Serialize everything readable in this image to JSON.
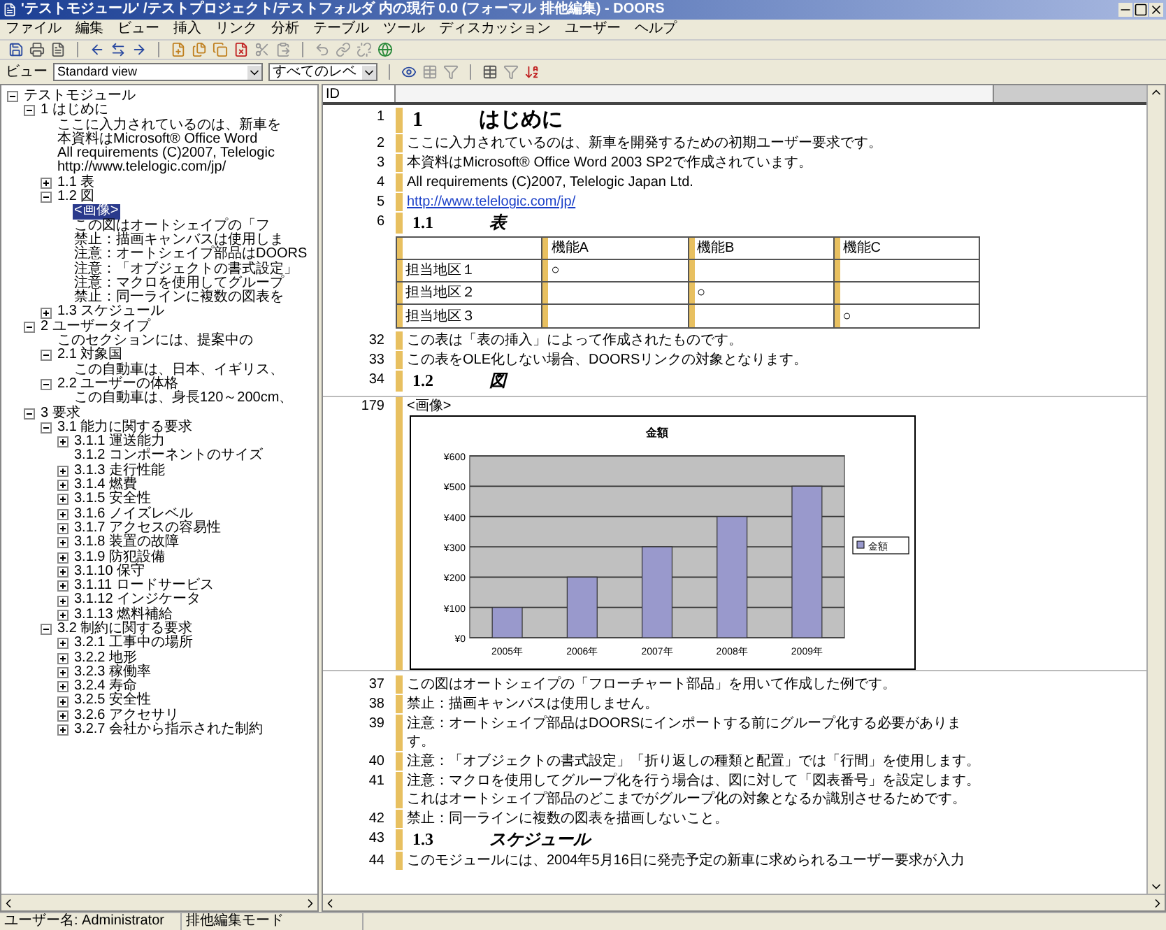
{
  "window": {
    "title": "'テストモジュール' /テストプロジェクト/テストフォルダ 内の現行 0.0 (フォーマル 排他編集) - DOORS"
  },
  "menu": [
    "ファイル",
    "編集",
    "ビュー",
    "挿入",
    "リンク",
    "分析",
    "テーブル",
    "ツール",
    "ディスカッション",
    "ユーザー",
    "ヘルプ"
  ],
  "view_bar": {
    "label": "ビュー",
    "view": "Standard view",
    "level": "すべてのレベ"
  },
  "columns": [
    "ID"
  ],
  "tree": [
    {
      "kind": "branch",
      "label": "テストモジュール",
      "expanded": true,
      "selected": false,
      "children": [
        {
          "kind": "branch",
          "label": "1 はじめに",
          "expanded": true,
          "selected": false,
          "children": [
            {
              "kind": "leaf",
              "label": "ここに入力されているのは、新車を",
              "selected": false
            },
            {
              "kind": "leaf",
              "label": "本資料はMicrosoft® Office Word",
              "selected": false
            },
            {
              "kind": "leaf",
              "label": "All requirements (C)2007, Telelogic",
              "selected": false
            },
            {
              "kind": "leaf",
              "label": "http://www.telelogic.com/jp/",
              "selected": false
            },
            {
              "kind": "branch",
              "label": "1.1 表",
              "expanded": false,
              "selected": false
            },
            {
              "kind": "branch",
              "label": "1.2 図",
              "expanded": true,
              "selected": false,
              "children": [
                {
                  "kind": "leaf",
                  "label": "<画像>",
                  "selected": true
                },
                {
                  "kind": "leaf",
                  "label": "この図はオートシェイプの「フ",
                  "selected": false
                },
                {
                  "kind": "leaf",
                  "label": "禁止：描画キャンバスは使用しま",
                  "selected": false
                },
                {
                  "kind": "leaf",
                  "label": "注意：オートシェイプ部品はDOORS",
                  "selected": false
                },
                {
                  "kind": "leaf",
                  "label": "注意：「オブジェクトの書式設定」",
                  "selected": false
                },
                {
                  "kind": "leaf",
                  "label": "注意：マクロを使用してグループ",
                  "selected": false
                },
                {
                  "kind": "leaf",
                  "label": "禁止：同一ラインに複数の図表を",
                  "selected": false
                }
              ]
            },
            {
              "kind": "branch",
              "label": "1.3 スケジュール",
              "expanded": false,
              "selected": false
            }
          ]
        },
        {
          "kind": "branch",
          "label": "2 ユーザータイプ",
          "expanded": true,
          "selected": false,
          "children": [
            {
              "kind": "leaf",
              "label": "このセクションには、提案中の",
              "selected": false
            },
            {
              "kind": "branch",
              "label": "2.1 対象国",
              "expanded": true,
              "selected": false,
              "children": [
                {
                  "kind": "leaf",
                  "label": "この自動車は、日本、イギリス、",
                  "selected": false
                }
              ]
            },
            {
              "kind": "branch",
              "label": "2.2 ユーザーの体格",
              "expanded": true,
              "selected": false,
              "children": [
                {
                  "kind": "leaf",
                  "label": "この自動車は、身長120～200cm、",
                  "selected": false
                }
              ]
            }
          ]
        },
        {
          "kind": "branch",
          "label": "3 要求",
          "expanded": true,
          "selected": false,
          "children": [
            {
              "kind": "branch",
              "label": "3.1 能力に関する要求",
              "expanded": true,
              "selected": false,
              "children": [
                {
                  "kind": "branch",
                  "label": "3.1.1 運送能力",
                  "expanded": false,
                  "selected": false
                },
                {
                  "kind": "leaf",
                  "label": "3.1.2 コンポーネントのサイズ",
                  "selected": false
                },
                {
                  "kind": "branch",
                  "label": "3.1.3 走行性能",
                  "expanded": false,
                  "selected": false
                },
                {
                  "kind": "branch",
                  "label": "3.1.4 燃費",
                  "expanded": false,
                  "selected": false
                },
                {
                  "kind": "branch",
                  "label": "3.1.5 安全性",
                  "expanded": false,
                  "selected": false
                },
                {
                  "kind": "branch",
                  "label": "3.1.6 ノイズレベル",
                  "expanded": false,
                  "selected": false
                },
                {
                  "kind": "branch",
                  "label": "3.1.7 アクセスの容易性",
                  "expanded": false,
                  "selected": false
                },
                {
                  "kind": "branch",
                  "label": "3.1.8 装置の故障",
                  "expanded": false,
                  "selected": false
                },
                {
                  "kind": "branch",
                  "label": "3.1.9 防犯設備",
                  "expanded": false,
                  "selected": false
                },
                {
                  "kind": "branch",
                  "label": "3.1.10 保守",
                  "expanded": false,
                  "selected": false
                },
                {
                  "kind": "branch",
                  "label": "3.1.11 ロードサービス",
                  "expanded": false,
                  "selected": false
                },
                {
                  "kind": "branch",
                  "label": "3.1.12 インジケータ",
                  "expanded": false,
                  "selected": false
                },
                {
                  "kind": "branch",
                  "label": "3.1.13 燃料補給",
                  "expanded": false,
                  "selected": false
                }
              ]
            },
            {
              "kind": "branch",
              "label": "3.2 制約に関する要求",
              "expanded": true,
              "selected": false,
              "children": [
                {
                  "kind": "branch",
                  "label": "3.2.1 工事中の場所",
                  "expanded": false,
                  "selected": false
                },
                {
                  "kind": "branch",
                  "label": "3.2.2 地形",
                  "expanded": false,
                  "selected": false
                },
                {
                  "kind": "branch",
                  "label": "3.2.3 稼働率",
                  "expanded": false,
                  "selected": false
                },
                {
                  "kind": "branch",
                  "label": "3.2.4 寿命",
                  "expanded": false,
                  "selected": false
                },
                {
                  "kind": "branch",
                  "label": "3.2.5 安全性",
                  "expanded": false,
                  "selected": false
                },
                {
                  "kind": "branch",
                  "label": "3.2.6 アクセサリ",
                  "expanded": false,
                  "selected": false
                },
                {
                  "kind": "branch",
                  "label": "3.2.7 会社から指示された制約",
                  "expanded": false,
                  "selected": false
                }
              ]
            }
          ]
        }
      ]
    }
  ],
  "rows": [
    {
      "kind": "heading",
      "id": "1",
      "number": "1",
      "title": "はじめに"
    },
    {
      "kind": "text",
      "id": "2",
      "text": "ここに入力されているのは、新車を開発するための初期ユーザー要求です。"
    },
    {
      "kind": "text",
      "id": "3",
      "text": "本資料はMicrosoft® Office Word 2003 SP2で作成されています。"
    },
    {
      "kind": "text",
      "id": "4",
      "text": "All requirements (C)2007, Telelogic Japan Ltd."
    },
    {
      "kind": "link",
      "id": "5",
      "text": "http://www.telelogic.com/jp/"
    },
    {
      "kind": "subheading",
      "id": "6",
      "number": "1.1",
      "title": "表"
    },
    {
      "kind": "table",
      "header": [
        "機能A",
        "機能B",
        "機能C"
      ],
      "cells": [
        [
          "担当地区１",
          "○",
          null,
          null
        ],
        [
          "担当地区２",
          null,
          "○",
          null
        ],
        [
          "担当地区３",
          null,
          null,
          "○"
        ]
      ]
    },
    {
      "kind": "text",
      "id": "32",
      "text": "この表は「表の挿入」によって作成されたものです。"
    },
    {
      "kind": "text",
      "id": "33",
      "text": "この表をOLE化しない場合、DOORSリンクの対象となります。"
    },
    {
      "kind": "subheading",
      "id": "34",
      "number": "1.2",
      "title": "図"
    },
    {
      "kind": "image",
      "id": "179",
      "caption": "<画像>",
      "chart_data": {
        "type": "bar",
        "grid": true,
        "title": "金額",
        "categories": [
          "2005年",
          "2006年",
          "2007年",
          "2008年",
          "2009年"
        ],
        "series": [
          {
            "name": "金額",
            "color": "#9999cc",
            "values": [
              100,
              200,
              300,
              400,
              500
            ]
          }
        ],
        "ylim": [
          0,
          600
        ],
        "yticks": [
          {
            "value": 0,
            "label": "¥0"
          },
          {
            "value": 100,
            "label": "¥100"
          },
          {
            "value": 200,
            "label": "¥200"
          },
          {
            "value": 300,
            "label": "¥300"
          },
          {
            "value": 400,
            "label": "¥400"
          },
          {
            "value": 500,
            "label": "¥500"
          },
          {
            "value": 600,
            "label": "¥600"
          }
        ]
      }
    },
    {
      "kind": "text",
      "id": "37",
      "text": "この図はオートシェイプの「フローチャート部品」を用いて作成した例です。"
    },
    {
      "kind": "text",
      "id": "38",
      "text": "禁止：描画キャンバスは使用しません。"
    },
    {
      "kind": "text",
      "id": "39",
      "text": "注意：オートシェイプ部品はDOORSにインポートする前にグループ化する必要があります。"
    },
    {
      "kind": "text",
      "id": "40",
      "text": "注意：「オブジェクトの書式設定」「折り返しの種類と配置」では「行間」を使用します。"
    },
    {
      "kind": "text",
      "id": "41",
      "text": "注意：マクロを使用してグループ化を行う場合は、図に対して「図表番号」を設定します。これはオートシェイプ部品のどこまでがグループ化の対象となるか識別させるためです。"
    },
    {
      "kind": "text",
      "id": "42",
      "text": "禁止：同一ラインに複数の図表を描画しないこと。"
    },
    {
      "kind": "subheading",
      "id": "43",
      "number": "1.3",
      "title": "スケジュール"
    },
    {
      "kind": "text",
      "id": "44",
      "text": "このモジュールには、2004年5月16日に発売予定の新車に求められるユーザー要求が入力"
    }
  ],
  "status_bar": [
    "ユーザー名: Administrator",
    "排他編集モード"
  ]
}
